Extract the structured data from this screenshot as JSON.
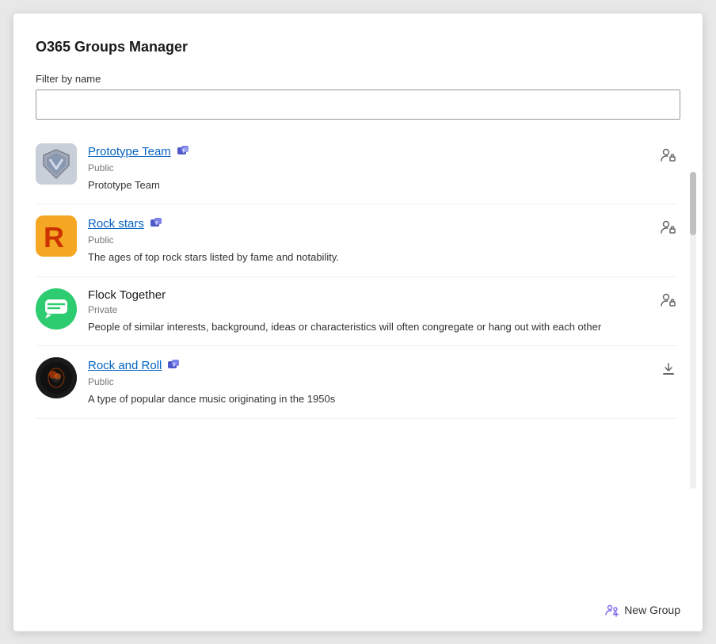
{
  "app": {
    "title": "O365 Groups Manager"
  },
  "filter": {
    "label": "Filter by name",
    "placeholder": "",
    "value": ""
  },
  "groups": [
    {
      "id": "prototype-team",
      "name": "Prototype Team",
      "hasLink": true,
      "hasTeams": true,
      "visibility": "Public",
      "description": "Prototype Team",
      "avatarType": "prototype",
      "actionIcon": "person-lock"
    },
    {
      "id": "rock-stars",
      "name": "Rock stars",
      "hasLink": true,
      "hasTeams": true,
      "visibility": "Public",
      "description": "The ages of top rock stars listed by fame and notability.",
      "avatarType": "rockstars",
      "actionIcon": "person-lock"
    },
    {
      "id": "flock-together",
      "name": "Flock Together",
      "hasLink": false,
      "hasTeams": false,
      "visibility": "Private",
      "description": "People of similar interests, background, ideas or characteristics will often congregate or hang out with each other",
      "avatarType": "flock",
      "actionIcon": "person-lock"
    },
    {
      "id": "rock-and-roll",
      "name": "Rock and Roll",
      "hasLink": true,
      "hasTeams": true,
      "visibility": "Public",
      "description": "A type of popular dance music originating in the 1950s",
      "avatarType": "rockroll",
      "actionIcon": "download"
    }
  ],
  "footer": {
    "newGroupLabel": "New Group",
    "newGroupIcon": "add-group-icon"
  }
}
